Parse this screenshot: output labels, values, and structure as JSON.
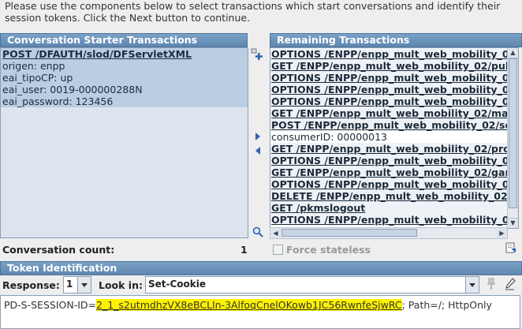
{
  "instructions": "Please use the components below to select transactions which start conversations and identify their\nsession tokens.  Click the Next button to continue.",
  "left_panel": {
    "title": "Conversation Starter Transactions",
    "items": [
      "POST /DFAUTH/slod/DFServletXML",
      "origen: enpp",
      "eai_tipoCP: up",
      "eai_user: 0019-000000288N",
      "eai_password: 123456"
    ]
  },
  "right_panel": {
    "title": "Remaining Transactions",
    "items": [
      {
        "text": "OPTIONS /ENPP/enpp_mult_web_mobility_02/",
        "style": "bold"
      },
      {
        "text": "GET /ENPP/enpp_mult_web_mobility_02/pub",
        "style": "bold"
      },
      {
        "text": "OPTIONS /ENPP/enpp_mult_web_mobility_02/",
        "style": "bold"
      },
      {
        "text": "OPTIONS /ENPP/enpp_mult_web_mobility_02/",
        "style": "bold"
      },
      {
        "text": "OPTIONS /ENPP/enpp_mult_web_mobility_02/",
        "style": "bold"
      },
      {
        "text": "GET /ENPP/enpp_mult_web_mobility_02/man",
        "style": "bold"
      },
      {
        "text": "POST /ENPP/enpp_mult_web_mobility_02/se",
        "style": "bold"
      },
      {
        "text": "consumerID: 00000013",
        "style": "plain"
      },
      {
        "text": "GET /ENPP/enpp_mult_web_mobility_02/prod",
        "style": "bold"
      },
      {
        "text": "OPTIONS /ENPP/enpp_mult_web_mobility_02/",
        "style": "bold"
      },
      {
        "text": "GET /ENPP/enpp_mult_web_mobility_02/gam",
        "style": "bold"
      },
      {
        "text": "OPTIONS /ENPP/enpp_mult_web_mobility_02/",
        "style": "bold"
      },
      {
        "text": "DELETE /ENPP/enpp_mult_web_mobility_02/s",
        "style": "bold"
      },
      {
        "text": "GET /pkmslogout",
        "style": "bold"
      },
      {
        "text": "OPTIONS /ENPP/enpp_mult_web_mobility_02/",
        "style": "bold"
      }
    ]
  },
  "conversation": {
    "label": "Conversation count:",
    "count": "1"
  },
  "force_stateless": {
    "label": "Force stateless",
    "checked": false
  },
  "token": {
    "title": "Token Identification",
    "response_label": "Response:",
    "response_value": "1",
    "lookin_label": "Look in:",
    "lookin_value": "Set-Cookie",
    "prefix": "PD-S-SESSION-ID=",
    "value": "2_1_s2utmdhzVX8eBCLln-3AlfoqCnelOKowb1JC56RwnfeSjwRC",
    "suffix": "; Path=/; HttpOnly"
  },
  "colors": {
    "header_blue": "#6a92ba",
    "highlight": "#fff200"
  },
  "icons": [
    "add-transaction-icon",
    "move-right-icon",
    "move-left-icon",
    "zoom-icon",
    "export-icon",
    "pin-icon",
    "edit-pen-icon"
  ]
}
